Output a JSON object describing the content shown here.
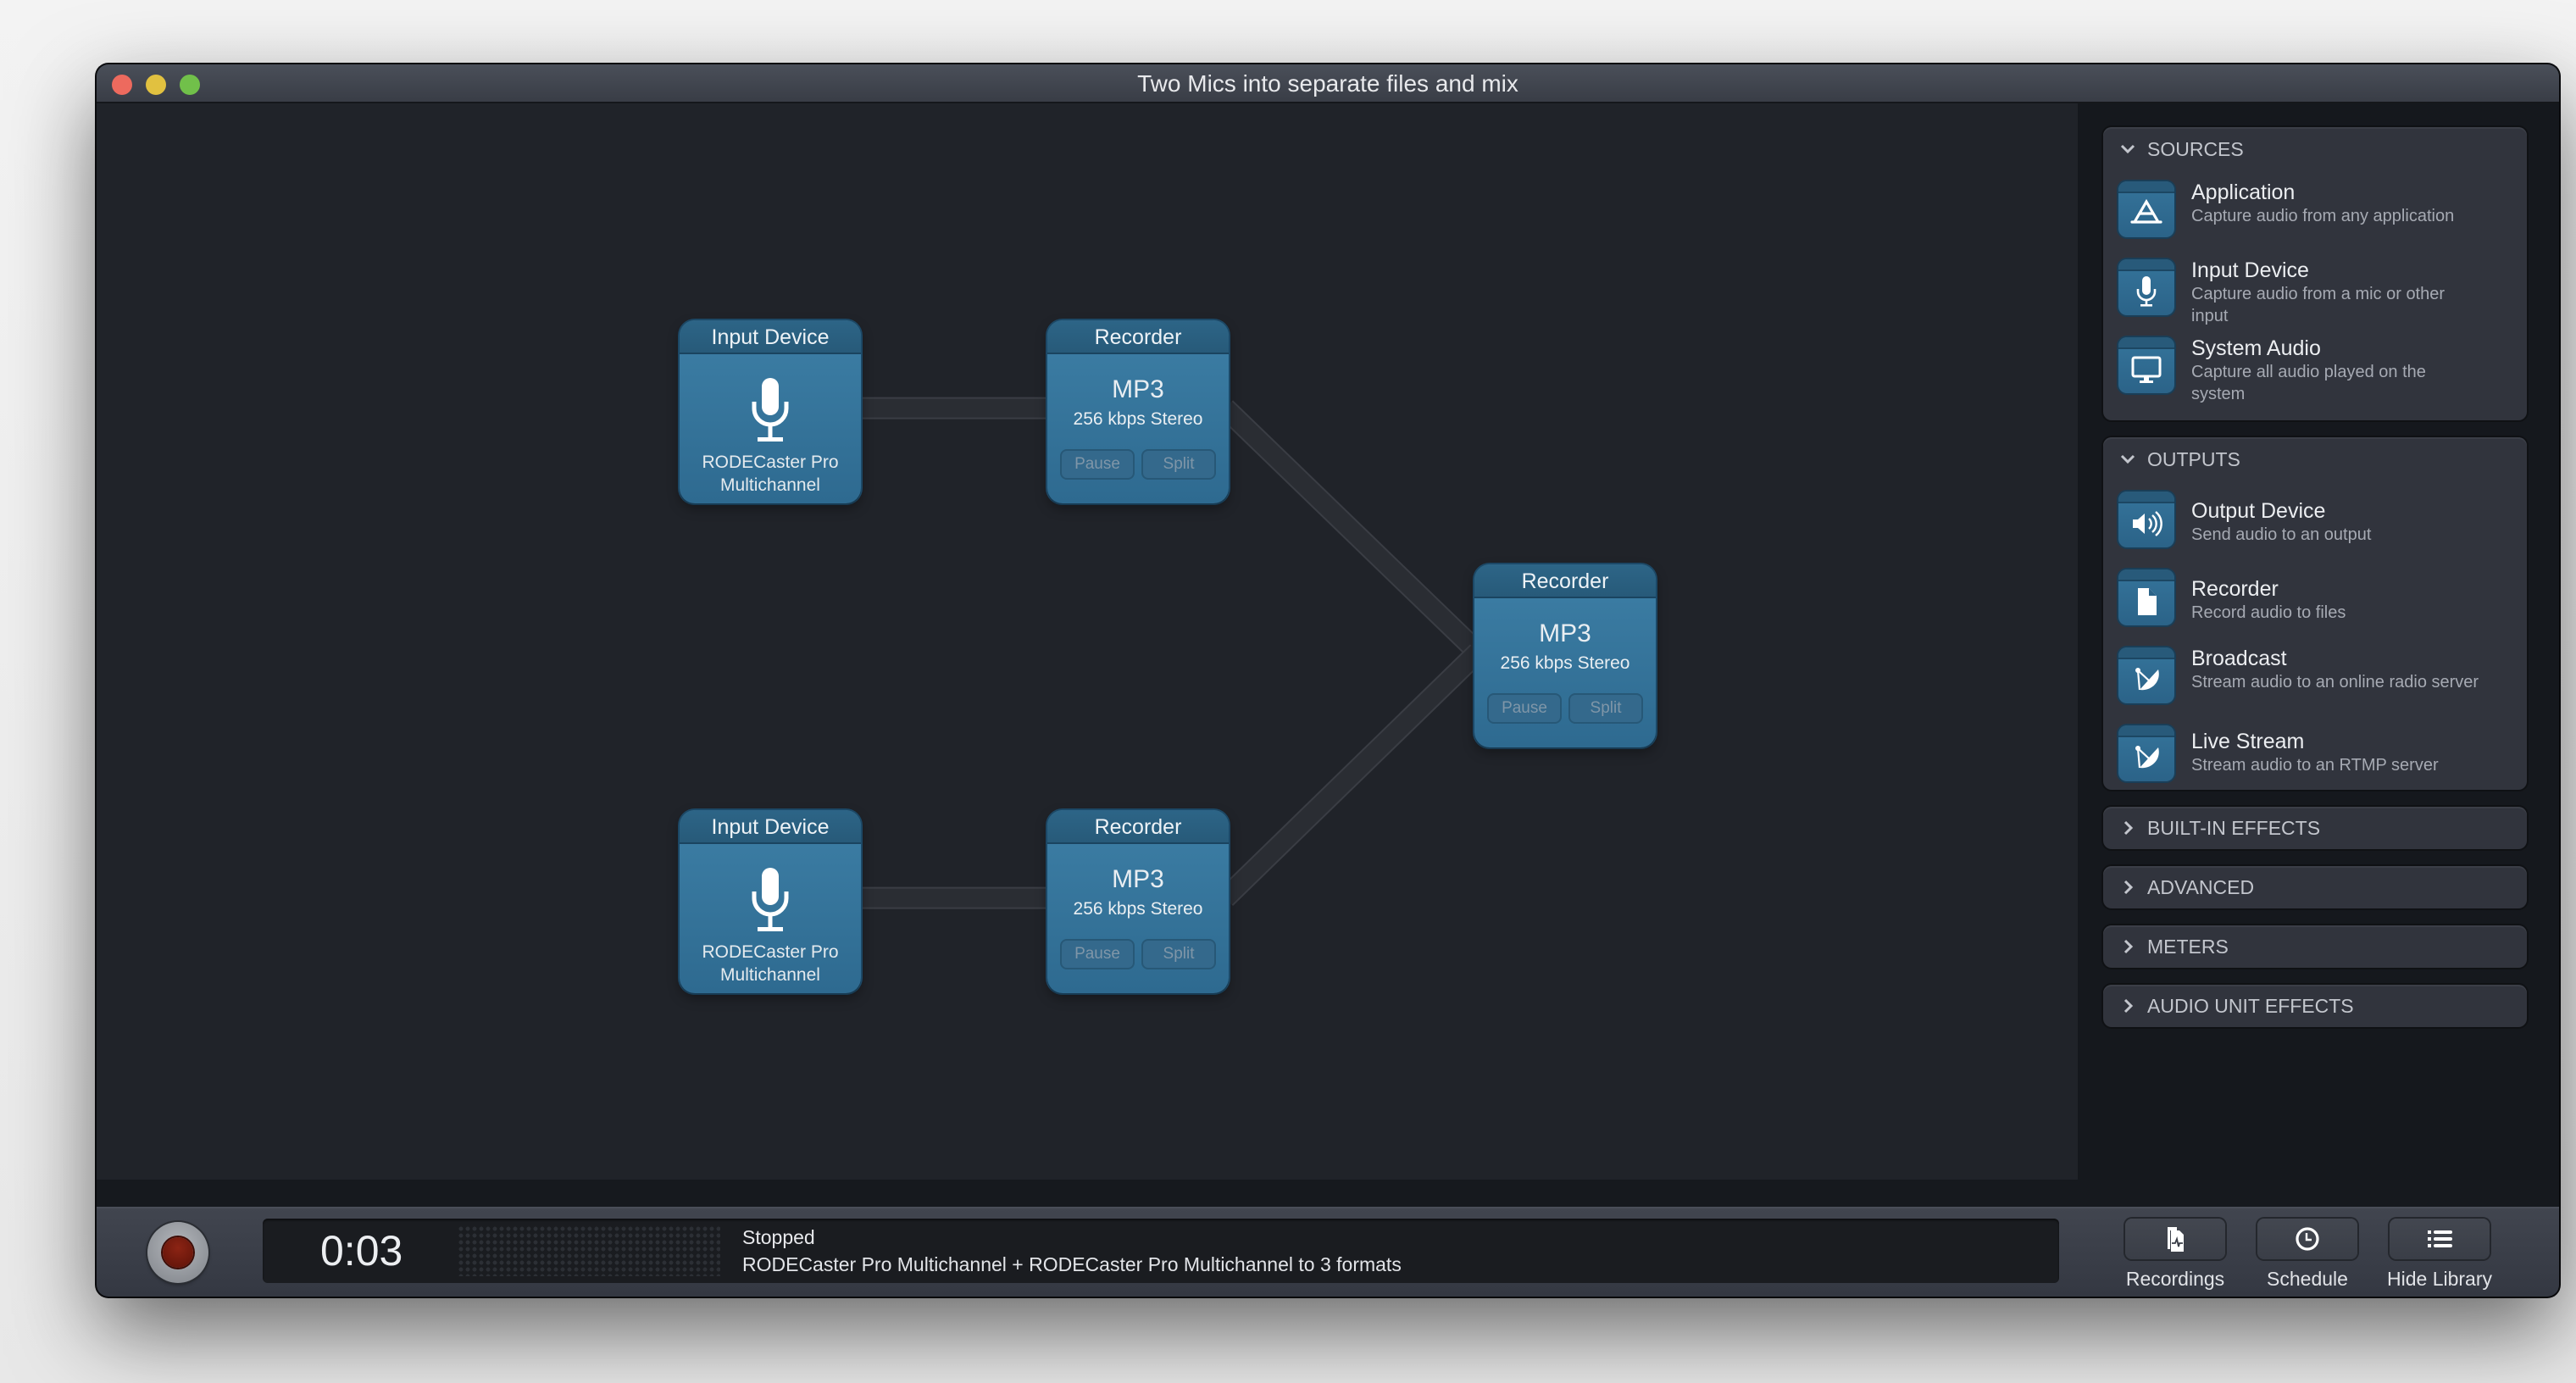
{
  "window": {
    "title": "Two Mics into separate files and mix"
  },
  "canvas": {
    "nodes": [
      {
        "id": "input1",
        "type": "Input Device",
        "device_line1": "RODECaster Pro",
        "device_line2": "Multichannel"
      },
      {
        "id": "rec1",
        "type": "Recorder",
        "format": "MP3",
        "rate": "256 kbps Stereo",
        "pause": "Pause",
        "split": "Split"
      },
      {
        "id": "recmix",
        "type": "Recorder",
        "format": "MP3",
        "rate": "256 kbps Stereo",
        "pause": "Pause",
        "split": "Split"
      },
      {
        "id": "input2",
        "type": "Input Device",
        "device_line1": "RODECaster Pro",
        "device_line2": "Multichannel"
      },
      {
        "id": "rec2",
        "type": "Recorder",
        "format": "MP3",
        "rate": "256 kbps Stereo",
        "pause": "Pause",
        "split": "Split"
      }
    ],
    "connections": [
      {
        "from": "input1",
        "to": "rec1"
      },
      {
        "from": "input2",
        "to": "rec2"
      },
      {
        "from": "rec1",
        "to": "recmix"
      },
      {
        "from": "rec2",
        "to": "recmix"
      }
    ]
  },
  "library": {
    "sources": {
      "label": "SOURCES",
      "expanded": true,
      "items": [
        {
          "title": "Application",
          "desc": "Capture audio from any application",
          "icon": "app-store-icon"
        },
        {
          "title": "Input Device",
          "desc": "Capture audio from a mic or other input",
          "icon": "microphone-icon"
        },
        {
          "title": "System Audio",
          "desc": "Capture all audio played on the system",
          "icon": "monitor-icon"
        }
      ]
    },
    "outputs": {
      "label": "OUTPUTS",
      "expanded": true,
      "items": [
        {
          "title": "Output Device",
          "desc": "Send audio to an output",
          "icon": "speaker-icon"
        },
        {
          "title": "Recorder",
          "desc": "Record audio to files",
          "icon": "document-icon"
        },
        {
          "title": "Broadcast",
          "desc": "Stream audio to an online radio server",
          "icon": "satellite-dish-icon"
        },
        {
          "title": "Live Stream",
          "desc": "Stream audio to an RTMP server",
          "icon": "satellite-dish-icon"
        }
      ]
    },
    "collapsed_sections": [
      {
        "label": "BUILT-IN EFFECTS"
      },
      {
        "label": "ADVANCED"
      },
      {
        "label": "METERS"
      },
      {
        "label": "AUDIO UNIT EFFECTS"
      }
    ]
  },
  "bottombar": {
    "elapsed": "0:03",
    "status": "Stopped",
    "description": "RODECaster Pro Multichannel + RODECaster Pro Multichannel to 3 formats",
    "tools": [
      {
        "label": "Recordings",
        "icon": "recordings-icon"
      },
      {
        "label": "Schedule",
        "icon": "clock-icon"
      },
      {
        "label": "Hide Library",
        "icon": "list-icon"
      }
    ]
  },
  "colors": {
    "node_blue": "#3a7aa1",
    "canvas_bg": "#202329",
    "sidebar_bg": "#15181d",
    "record_red": "#7a1c0e"
  }
}
